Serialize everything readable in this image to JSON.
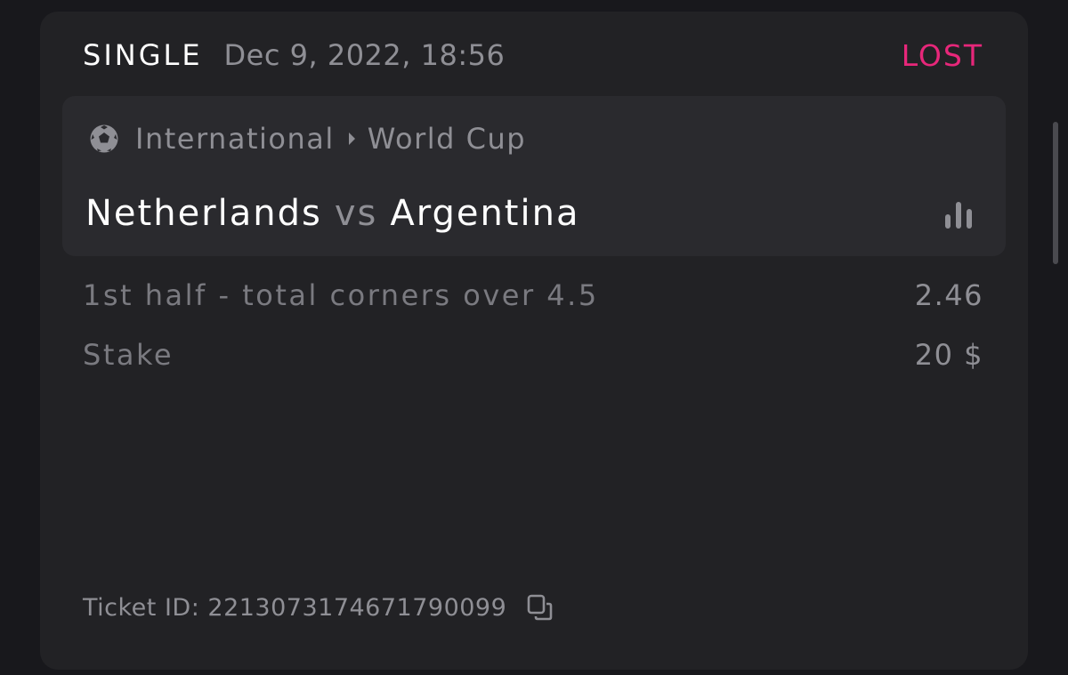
{
  "bet": {
    "type": "SINGLE",
    "date": "Dec 9, 2022, 18:56",
    "status": "LOST",
    "status_color": "#e7277a"
  },
  "event": {
    "sport_icon": "soccer-ball-icon",
    "category": "International",
    "tournament": "World Cup",
    "home_team": "Netherlands",
    "vs": "vs",
    "away_team": "Argentina",
    "stats_icon": "bar-chart-icon"
  },
  "selection": {
    "market": "1st half - total corners over 4.5",
    "odds": "2.46"
  },
  "stake": {
    "label": "Stake",
    "value": "20 $"
  },
  "ticket": {
    "text": "Ticket ID: 2213073174671790099",
    "copy_icon": "copy-icon"
  }
}
